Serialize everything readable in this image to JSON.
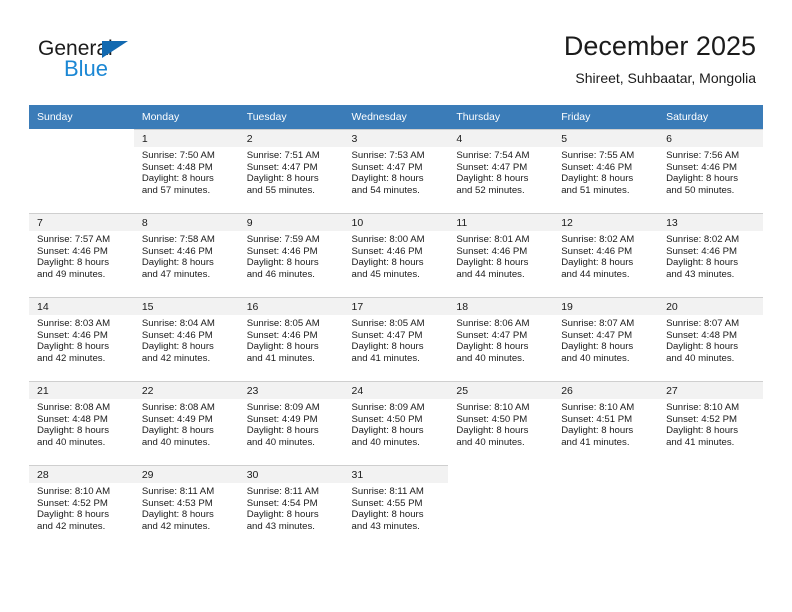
{
  "brand": {
    "name_top": "General",
    "name_bottom": "Blue",
    "triangle_color": "#1269b0",
    "blue_color": "#1b87d4"
  },
  "header": {
    "title": "December 2025",
    "subtitle": "Shireet, Suhbaatar, Mongolia"
  },
  "theme": {
    "header_row_bg": "#3b7cb8",
    "daynum_band_bg": "#f2f2f2",
    "grid_line": "#cfcfcf",
    "text": "#1b1b1b"
  },
  "weekday_headers": [
    "Sunday",
    "Monday",
    "Tuesday",
    "Wednesday",
    "Thursday",
    "Friday",
    "Saturday"
  ],
  "weeks": [
    [
      {
        "day": "",
        "sunrise": "",
        "sunset": "",
        "daylight_line1": "",
        "daylight_line2": ""
      },
      {
        "day": "1",
        "sunrise": "Sunrise: 7:50 AM",
        "sunset": "Sunset: 4:48 PM",
        "daylight_line1": "Daylight: 8 hours",
        "daylight_line2": "and 57 minutes."
      },
      {
        "day": "2",
        "sunrise": "Sunrise: 7:51 AM",
        "sunset": "Sunset: 4:47 PM",
        "daylight_line1": "Daylight: 8 hours",
        "daylight_line2": "and 55 minutes."
      },
      {
        "day": "3",
        "sunrise": "Sunrise: 7:53 AM",
        "sunset": "Sunset: 4:47 PM",
        "daylight_line1": "Daylight: 8 hours",
        "daylight_line2": "and 54 minutes."
      },
      {
        "day": "4",
        "sunrise": "Sunrise: 7:54 AM",
        "sunset": "Sunset: 4:47 PM",
        "daylight_line1": "Daylight: 8 hours",
        "daylight_line2": "and 52 minutes."
      },
      {
        "day": "5",
        "sunrise": "Sunrise: 7:55 AM",
        "sunset": "Sunset: 4:46 PM",
        "daylight_line1": "Daylight: 8 hours",
        "daylight_line2": "and 51 minutes."
      },
      {
        "day": "6",
        "sunrise": "Sunrise: 7:56 AM",
        "sunset": "Sunset: 4:46 PM",
        "daylight_line1": "Daylight: 8 hours",
        "daylight_line2": "and 50 minutes."
      }
    ],
    [
      {
        "day": "7",
        "sunrise": "Sunrise: 7:57 AM",
        "sunset": "Sunset: 4:46 PM",
        "daylight_line1": "Daylight: 8 hours",
        "daylight_line2": "and 49 minutes."
      },
      {
        "day": "8",
        "sunrise": "Sunrise: 7:58 AM",
        "sunset": "Sunset: 4:46 PM",
        "daylight_line1": "Daylight: 8 hours",
        "daylight_line2": "and 47 minutes."
      },
      {
        "day": "9",
        "sunrise": "Sunrise: 7:59 AM",
        "sunset": "Sunset: 4:46 PM",
        "daylight_line1": "Daylight: 8 hours",
        "daylight_line2": "and 46 minutes."
      },
      {
        "day": "10",
        "sunrise": "Sunrise: 8:00 AM",
        "sunset": "Sunset: 4:46 PM",
        "daylight_line1": "Daylight: 8 hours",
        "daylight_line2": "and 45 minutes."
      },
      {
        "day": "11",
        "sunrise": "Sunrise: 8:01 AM",
        "sunset": "Sunset: 4:46 PM",
        "daylight_line1": "Daylight: 8 hours",
        "daylight_line2": "and 44 minutes."
      },
      {
        "day": "12",
        "sunrise": "Sunrise: 8:02 AM",
        "sunset": "Sunset: 4:46 PM",
        "daylight_line1": "Daylight: 8 hours",
        "daylight_line2": "and 44 minutes."
      },
      {
        "day": "13",
        "sunrise": "Sunrise: 8:02 AM",
        "sunset": "Sunset: 4:46 PM",
        "daylight_line1": "Daylight: 8 hours",
        "daylight_line2": "and 43 minutes."
      }
    ],
    [
      {
        "day": "14",
        "sunrise": "Sunrise: 8:03 AM",
        "sunset": "Sunset: 4:46 PM",
        "daylight_line1": "Daylight: 8 hours",
        "daylight_line2": "and 42 minutes."
      },
      {
        "day": "15",
        "sunrise": "Sunrise: 8:04 AM",
        "sunset": "Sunset: 4:46 PM",
        "daylight_line1": "Daylight: 8 hours",
        "daylight_line2": "and 42 minutes."
      },
      {
        "day": "16",
        "sunrise": "Sunrise: 8:05 AM",
        "sunset": "Sunset: 4:46 PM",
        "daylight_line1": "Daylight: 8 hours",
        "daylight_line2": "and 41 minutes."
      },
      {
        "day": "17",
        "sunrise": "Sunrise: 8:05 AM",
        "sunset": "Sunset: 4:47 PM",
        "daylight_line1": "Daylight: 8 hours",
        "daylight_line2": "and 41 minutes."
      },
      {
        "day": "18",
        "sunrise": "Sunrise: 8:06 AM",
        "sunset": "Sunset: 4:47 PM",
        "daylight_line1": "Daylight: 8 hours",
        "daylight_line2": "and 40 minutes."
      },
      {
        "day": "19",
        "sunrise": "Sunrise: 8:07 AM",
        "sunset": "Sunset: 4:47 PM",
        "daylight_line1": "Daylight: 8 hours",
        "daylight_line2": "and 40 minutes."
      },
      {
        "day": "20",
        "sunrise": "Sunrise: 8:07 AM",
        "sunset": "Sunset: 4:48 PM",
        "daylight_line1": "Daylight: 8 hours",
        "daylight_line2": "and 40 minutes."
      }
    ],
    [
      {
        "day": "21",
        "sunrise": "Sunrise: 8:08 AM",
        "sunset": "Sunset: 4:48 PM",
        "daylight_line1": "Daylight: 8 hours",
        "daylight_line2": "and 40 minutes."
      },
      {
        "day": "22",
        "sunrise": "Sunrise: 8:08 AM",
        "sunset": "Sunset: 4:49 PM",
        "daylight_line1": "Daylight: 8 hours",
        "daylight_line2": "and 40 minutes."
      },
      {
        "day": "23",
        "sunrise": "Sunrise: 8:09 AM",
        "sunset": "Sunset: 4:49 PM",
        "daylight_line1": "Daylight: 8 hours",
        "daylight_line2": "and 40 minutes."
      },
      {
        "day": "24",
        "sunrise": "Sunrise: 8:09 AM",
        "sunset": "Sunset: 4:50 PM",
        "daylight_line1": "Daylight: 8 hours",
        "daylight_line2": "and 40 minutes."
      },
      {
        "day": "25",
        "sunrise": "Sunrise: 8:10 AM",
        "sunset": "Sunset: 4:50 PM",
        "daylight_line1": "Daylight: 8 hours",
        "daylight_line2": "and 40 minutes."
      },
      {
        "day": "26",
        "sunrise": "Sunrise: 8:10 AM",
        "sunset": "Sunset: 4:51 PM",
        "daylight_line1": "Daylight: 8 hours",
        "daylight_line2": "and 41 minutes."
      },
      {
        "day": "27",
        "sunrise": "Sunrise: 8:10 AM",
        "sunset": "Sunset: 4:52 PM",
        "daylight_line1": "Daylight: 8 hours",
        "daylight_line2": "and 41 minutes."
      }
    ],
    [
      {
        "day": "28",
        "sunrise": "Sunrise: 8:10 AM",
        "sunset": "Sunset: 4:52 PM",
        "daylight_line1": "Daylight: 8 hours",
        "daylight_line2": "and 42 minutes."
      },
      {
        "day": "29",
        "sunrise": "Sunrise: 8:11 AM",
        "sunset": "Sunset: 4:53 PM",
        "daylight_line1": "Daylight: 8 hours",
        "daylight_line2": "and 42 minutes."
      },
      {
        "day": "30",
        "sunrise": "Sunrise: 8:11 AM",
        "sunset": "Sunset: 4:54 PM",
        "daylight_line1": "Daylight: 8 hours",
        "daylight_line2": "and 43 minutes."
      },
      {
        "day": "31",
        "sunrise": "Sunrise: 8:11 AM",
        "sunset": "Sunset: 4:55 PM",
        "daylight_line1": "Daylight: 8 hours",
        "daylight_line2": "and 43 minutes."
      },
      {
        "day": "",
        "sunrise": "",
        "sunset": "",
        "daylight_line1": "",
        "daylight_line2": ""
      },
      {
        "day": "",
        "sunrise": "",
        "sunset": "",
        "daylight_line1": "",
        "daylight_line2": ""
      },
      {
        "day": "",
        "sunrise": "",
        "sunset": "",
        "daylight_line1": "",
        "daylight_line2": ""
      }
    ]
  ]
}
